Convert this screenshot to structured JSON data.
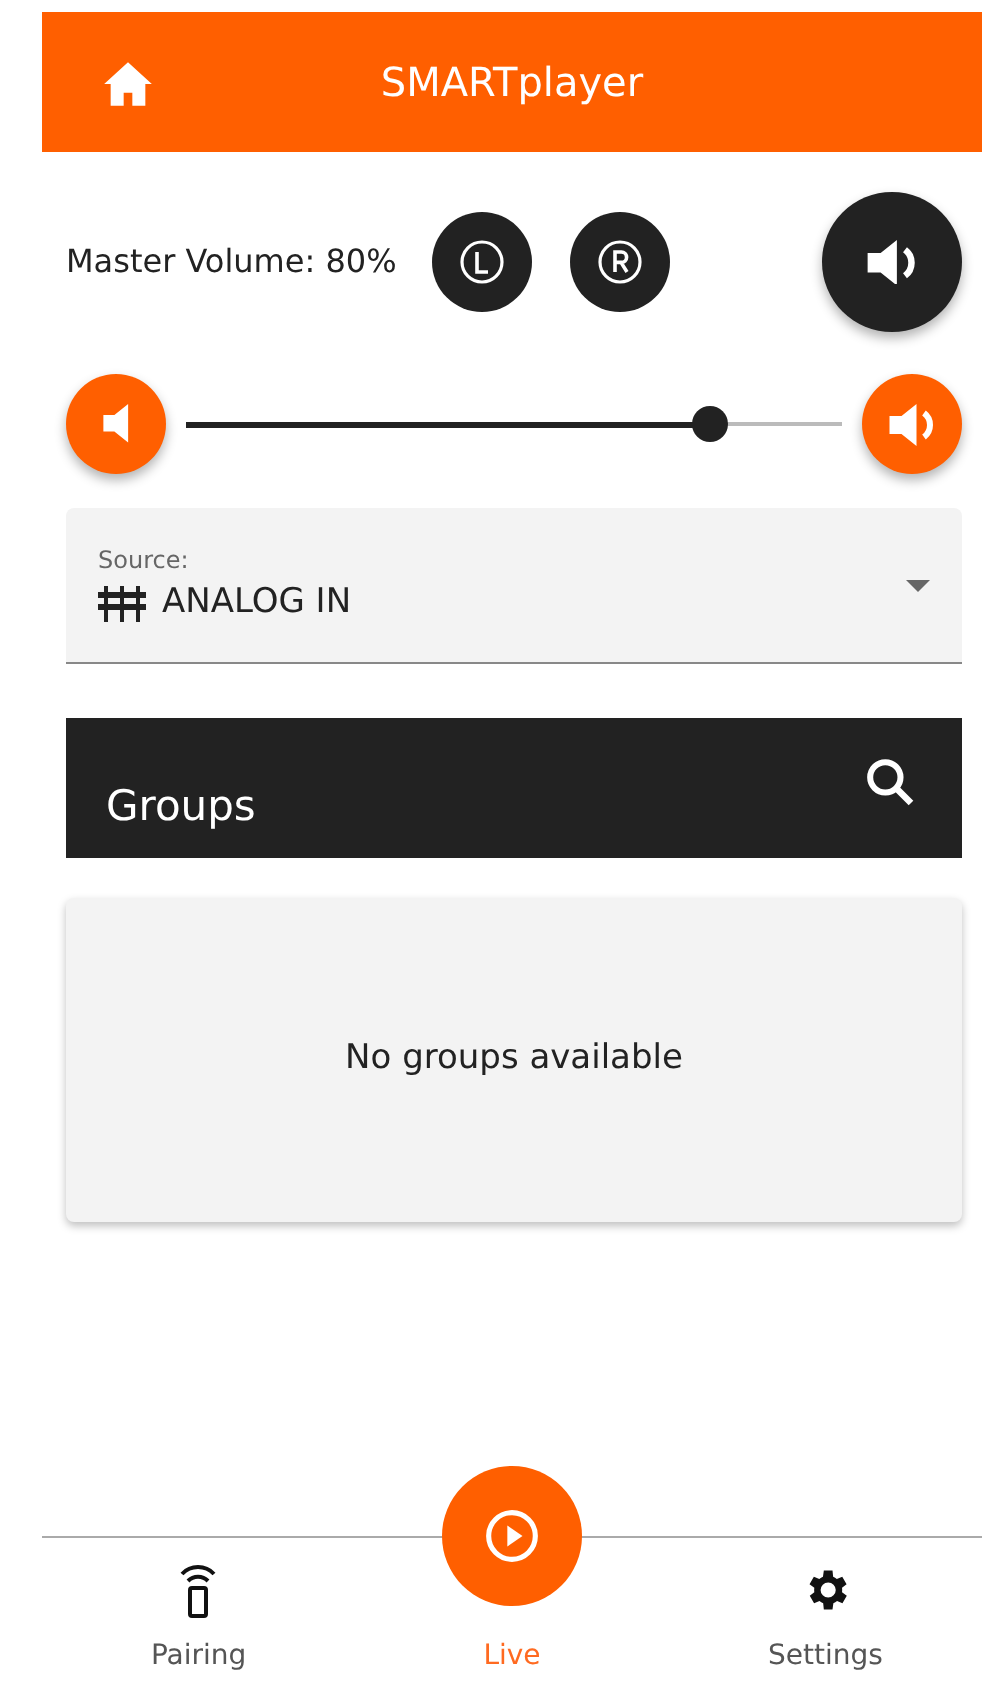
{
  "header": {
    "title": "SMARTplayer"
  },
  "master": {
    "label": "Master Volume: 80%",
    "level": 0.8
  },
  "source": {
    "label": "Source:",
    "value": "ANALOG IN"
  },
  "groups": {
    "title": "Groups",
    "empty_text": "No groups available"
  },
  "nav": [
    {
      "label": "Pairing",
      "kind": "pairing",
      "selected": false
    },
    {
      "label": "Live",
      "kind": "live",
      "selected": true
    },
    {
      "label": "Settings",
      "kind": "settings",
      "selected": false
    }
  ]
}
